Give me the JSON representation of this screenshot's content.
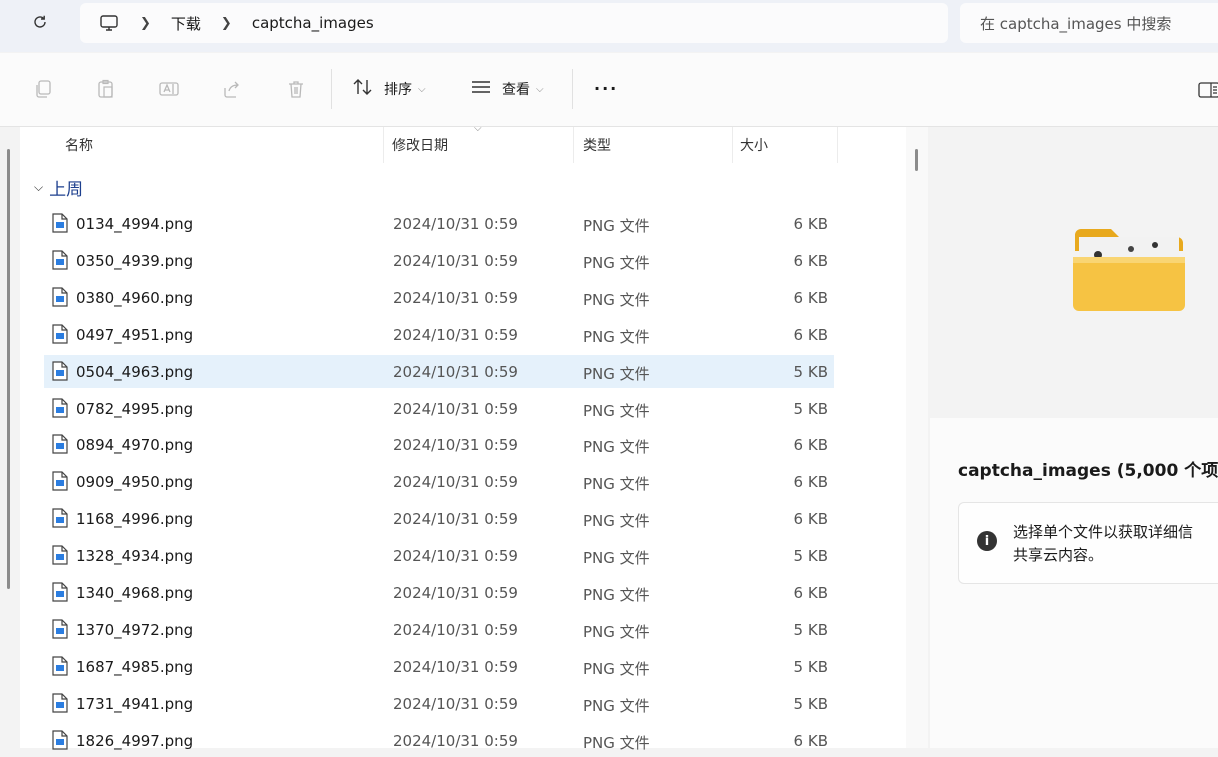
{
  "address": {
    "crumbs": [
      "下载",
      "captcha_images"
    ],
    "search_placeholder": "在 captcha_images 中搜索"
  },
  "toolbar": {
    "sort_label": "排序",
    "view_label": "查看",
    "more_label": "···"
  },
  "columns": {
    "name": "名称",
    "date": "修改日期",
    "type": "类型",
    "size": "大小"
  },
  "group_label": "上周",
  "files": [
    {
      "name": "0134_4994.png",
      "date": "2024/10/31 0:59",
      "type": "PNG 文件",
      "size": "6 KB"
    },
    {
      "name": "0350_4939.png",
      "date": "2024/10/31 0:59",
      "type": "PNG 文件",
      "size": "6 KB"
    },
    {
      "name": "0380_4960.png",
      "date": "2024/10/31 0:59",
      "type": "PNG 文件",
      "size": "6 KB"
    },
    {
      "name": "0497_4951.png",
      "date": "2024/10/31 0:59",
      "type": "PNG 文件",
      "size": "6 KB"
    },
    {
      "name": "0504_4963.png",
      "date": "2024/10/31 0:59",
      "type": "PNG 文件",
      "size": "5 KB",
      "selected": true
    },
    {
      "name": "0782_4995.png",
      "date": "2024/10/31 0:59",
      "type": "PNG 文件",
      "size": "5 KB"
    },
    {
      "name": "0894_4970.png",
      "date": "2024/10/31 0:59",
      "type": "PNG 文件",
      "size": "6 KB"
    },
    {
      "name": "0909_4950.png",
      "date": "2024/10/31 0:59",
      "type": "PNG 文件",
      "size": "6 KB"
    },
    {
      "name": "1168_4996.png",
      "date": "2024/10/31 0:59",
      "type": "PNG 文件",
      "size": "6 KB"
    },
    {
      "name": "1328_4934.png",
      "date": "2024/10/31 0:59",
      "type": "PNG 文件",
      "size": "5 KB"
    },
    {
      "name": "1340_4968.png",
      "date": "2024/10/31 0:59",
      "type": "PNG 文件",
      "size": "6 KB"
    },
    {
      "name": "1370_4972.png",
      "date": "2024/10/31 0:59",
      "type": "PNG 文件",
      "size": "5 KB"
    },
    {
      "name": "1687_4985.png",
      "date": "2024/10/31 0:59",
      "type": "PNG 文件",
      "size": "5 KB"
    },
    {
      "name": "1731_4941.png",
      "date": "2024/10/31 0:59",
      "type": "PNG 文件",
      "size": "5 KB"
    },
    {
      "name": "1826_4997.png",
      "date": "2024/10/31 0:59",
      "type": "PNG 文件",
      "size": "6 KB"
    }
  ],
  "details": {
    "title": "captcha_images (5,000 个项",
    "info_line1": "选择单个文件以获取详细信",
    "info_line2": "共享云内容。"
  },
  "colors": {
    "selected_row": "#e5f1fb",
    "group_text": "#1d3f8e",
    "folder": "#f6c343"
  }
}
